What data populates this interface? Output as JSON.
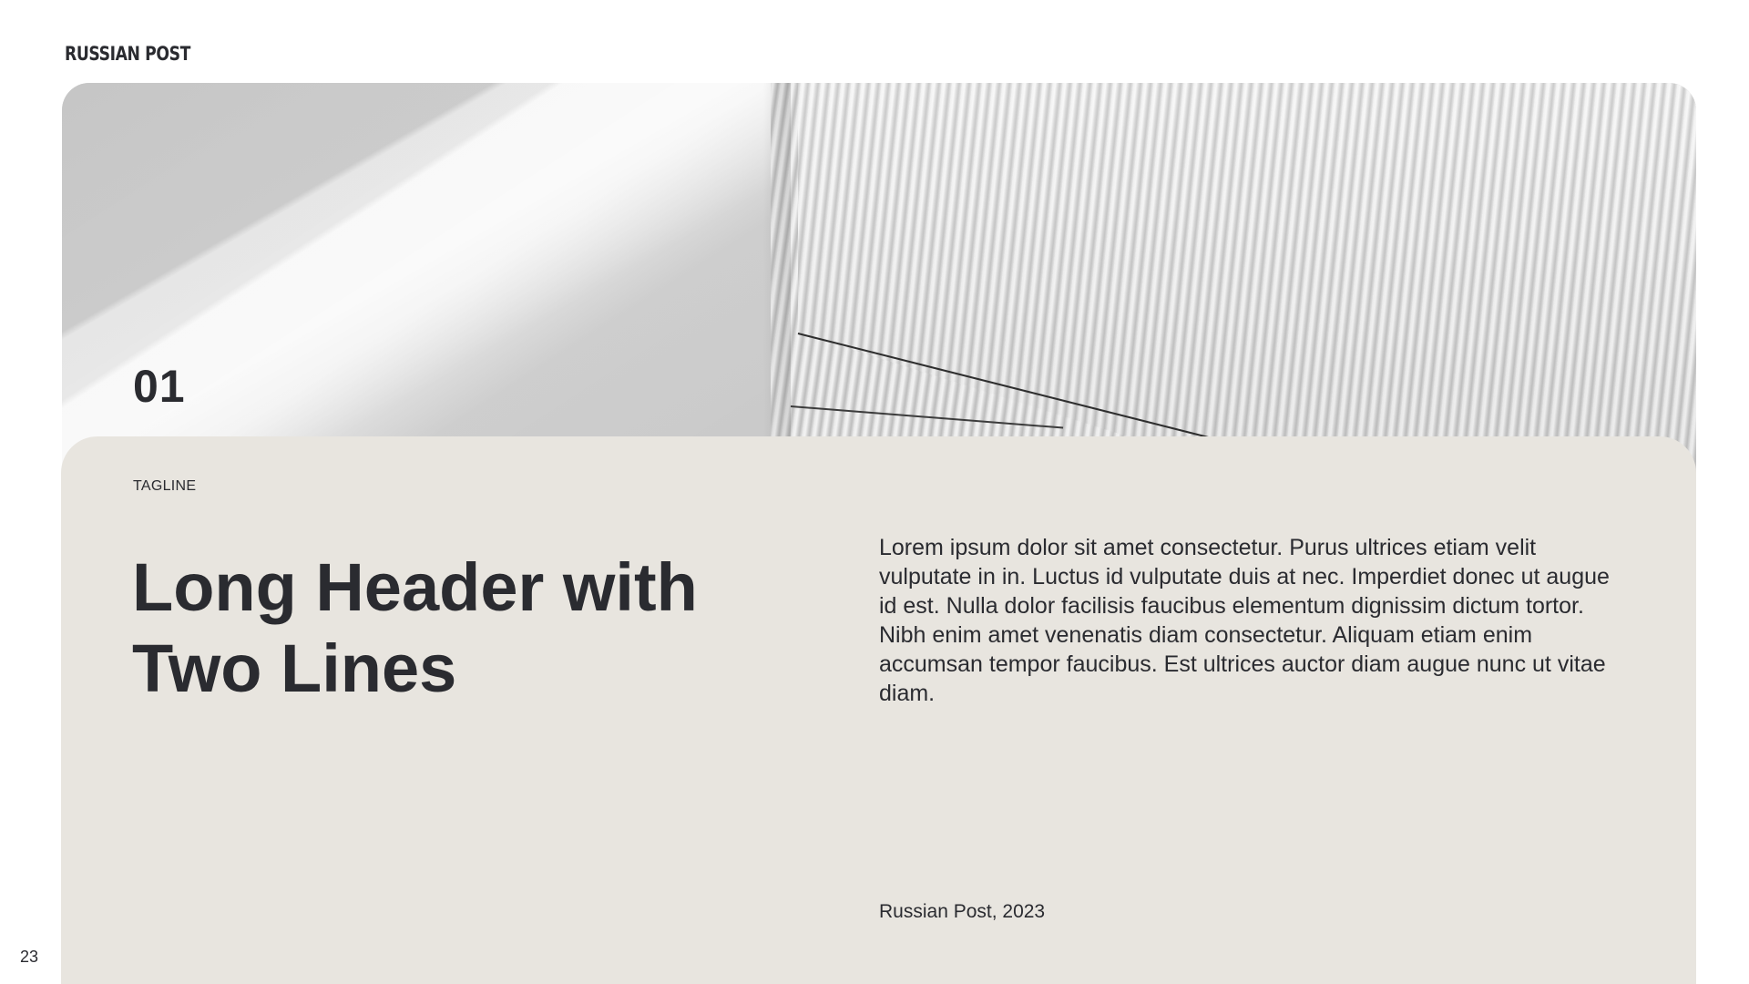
{
  "brand": {
    "logo_text": "RUSSIAN POST"
  },
  "hero": {
    "section_number": "01"
  },
  "content": {
    "tagline": "TAGLINE",
    "header": "Long Header with Two Lines",
    "body": "Lorem ipsum dolor sit amet consectetur. Purus ultrices etiam velit vulputate in in. Luctus id vulputate duis at nec. Imperdiet donec ut augue id est. Nulla dolor facilisis faucibus elementum dignissim dictum tortor. Nibh enim amet venenatis diam consectetur. Aliquam etiam enim accumsan tempor faucibus. Est ultrices auctor diam augue nunc ut vitae diam.",
    "footer_note": "Russian Post, 2023"
  },
  "page": {
    "number": "23"
  },
  "colors": {
    "text": "#2a2b30",
    "card_background": "#e8e5df",
    "page_background": "#ffffff"
  }
}
